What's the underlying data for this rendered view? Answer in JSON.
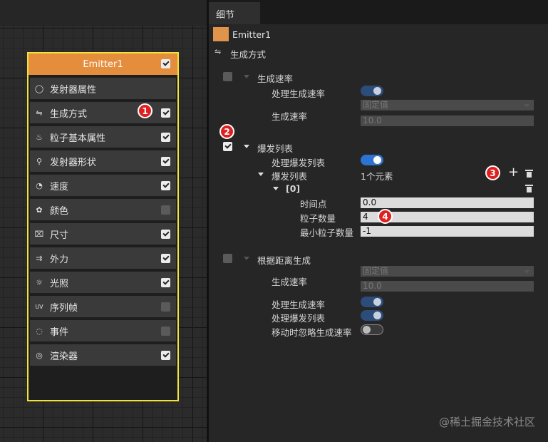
{
  "node": {
    "title": "Emitter1",
    "modules": [
      {
        "label": "发射器属性",
        "icon": "circle-icon",
        "glyph": "◯",
        "checkbox": "none"
      },
      {
        "label": "生成方式",
        "icon": "sliders-icon",
        "glyph": "⇋",
        "checkbox": "on"
      },
      {
        "label": "粒子基本属性",
        "icon": "flame-icon",
        "glyph": "♨",
        "checkbox": "on"
      },
      {
        "label": "发射器形状",
        "icon": "location-pin-icon",
        "glyph": "⚲",
        "checkbox": "on"
      },
      {
        "label": "速度",
        "icon": "speedometer-icon",
        "glyph": "◔",
        "checkbox": "on"
      },
      {
        "label": "颜色",
        "icon": "palette-icon",
        "glyph": "✿",
        "checkbox": "off"
      },
      {
        "label": "尺寸",
        "icon": "ruler-icon",
        "glyph": "⌧",
        "checkbox": "on"
      },
      {
        "label": "外力",
        "icon": "arrows-icon",
        "glyph": "⇉",
        "checkbox": "on"
      },
      {
        "label": "光照",
        "icon": "sun-icon",
        "glyph": "☼",
        "checkbox": "on"
      },
      {
        "label": "序列帧",
        "icon": "uv-icon",
        "glyph": "UV",
        "checkbox": "off"
      },
      {
        "label": "事件",
        "icon": "dashed-circle-icon",
        "glyph": "◌",
        "checkbox": "off"
      },
      {
        "label": "渲染器",
        "icon": "fingerprint-icon",
        "glyph": "◎",
        "checkbox": "on"
      }
    ]
  },
  "badges": [
    "1",
    "2",
    "3",
    "4"
  ],
  "details": {
    "tab": "细节",
    "emitter_name": "Emitter1",
    "section_title": "生成方式",
    "spawn_rate": {
      "header": "生成速率",
      "process_label": "处理生成速率",
      "rate_label": "生成速率",
      "dropdown_value": "固定值",
      "value": "10.0"
    },
    "burst": {
      "header": "爆发列表",
      "process_label": "处理爆发列表",
      "list_label": "爆发列表",
      "count_text": "1个元素",
      "index_label": "[0]",
      "time_label": "时间点",
      "time_value": "0.0",
      "count_label": "粒子数量",
      "count_value": "4",
      "min_label": "最小粒子数量",
      "min_value": "-1"
    },
    "distance": {
      "header": "根据距离生成",
      "rate_label": "生成速率",
      "dropdown_value": "固定值",
      "value": "10.0",
      "process_rate_label": "处理生成速率",
      "process_burst_label": "处理爆发列表",
      "ignore_label": "移动时忽略生成速率"
    }
  },
  "watermark": "@稀土掘金技术社区",
  "colors": {
    "accent": "#e38d3d",
    "highlight": "#f2e23a",
    "toggle_on": "#2d73d2",
    "badge": "#e02020"
  }
}
